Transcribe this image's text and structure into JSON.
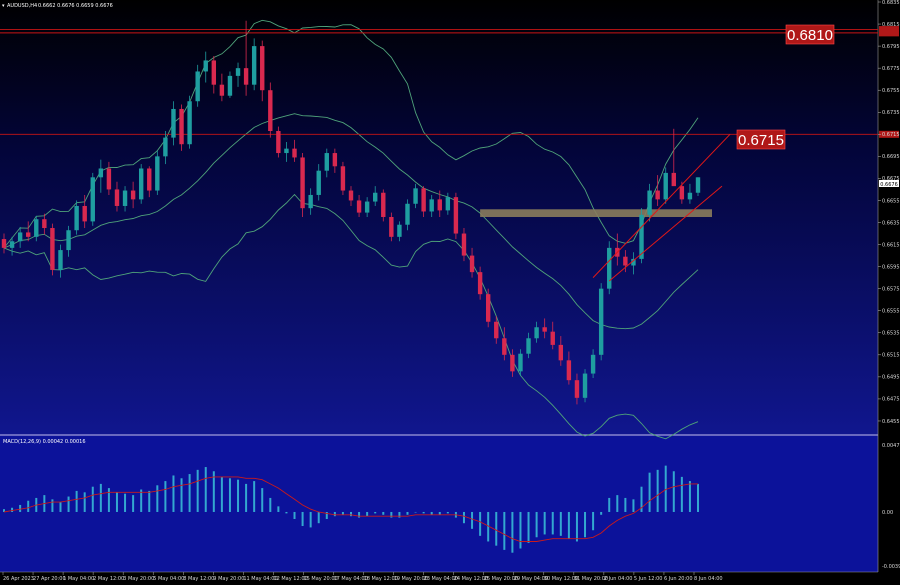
{
  "chart_header": {
    "symbol_label": "AUDUSD,H4",
    "ohlc_label": "0.6662 0.6676 0.6659 0.6676"
  },
  "indicator_header": {
    "label": "MACD(12,26,9) 0.00042 0.00016"
  },
  "price_axis": {
    "ticks": [
      "0.6835",
      "0.6815",
      "0.6795",
      "0.6775",
      "0.6755",
      "0.6735",
      "0.6715",
      "0.6695",
      "0.6675",
      "0.6655",
      "0.6635",
      "0.6615",
      "0.6595",
      "0.6575",
      "0.6555",
      "0.6535",
      "0.6515",
      "0.6495",
      "0.6475",
      "0.6455"
    ],
    "current_price_label": "0.6676"
  },
  "macd_axis": {
    "ticks": [
      "0.00477",
      "0.00",
      "-0.00399"
    ]
  },
  "time_axis": {
    "ticks": [
      "26 Apr 2023",
      "27 Apr 20:00",
      "1 May 04:00",
      "2 May 12:00",
      "3 May 20:00",
      "5 May 04:00",
      "8 May 12:00",
      "9 May 20:00",
      "11 May 04:00",
      "12 May 12:00",
      "15 May 20:00",
      "17 May 04:00",
      "18 May 12:00",
      "19 May 20:00",
      "23 May 04:00",
      "24 May 12:00",
      "25 May 20:00",
      "29 May 04:00",
      "30 May 12:00",
      "31 May 20:00",
      "2 Jun 04:00",
      "5 Jun 12:00",
      "6 Jun 20:00",
      "8 Jun 04:00"
    ]
  },
  "annotations": {
    "level_high_label": "0.6810",
    "level_mid_label": "0.6715"
  },
  "colors": {
    "background_top": "#000000",
    "background_bottom": "#0f1488",
    "bull_candle": "#1f9ea0",
    "bear_candle": "#d9294f",
    "bollinger": "#4fa37a",
    "level_line": "#c81414",
    "level_box_fill": "#b01818",
    "support_zone": "#8a7c5c",
    "trend_line": "#e01818",
    "macd_panel_bg": "#0c129a",
    "macd_hist": "#33a8d0",
    "macd_signal": "#cc1a1a"
  },
  "chart_data": {
    "type": "candlestick",
    "title": "",
    "symbol": "AUDUSD",
    "timeframe": "H4",
    "ylim": [
      0.6445,
      0.6835
    ],
    "horizontal_levels": [
      0.681,
      0.6807,
      0.6715
    ],
    "support_zone": [
      0.664,
      0.6647
    ],
    "ohlc": [
      [
        0.662,
        0.6625,
        0.6607,
        0.6612
      ],
      [
        0.6612,
        0.6622,
        0.6605,
        0.6618
      ],
      [
        0.6618,
        0.6631,
        0.6612,
        0.6626
      ],
      [
        0.6626,
        0.6636,
        0.6618,
        0.6622
      ],
      [
        0.6622,
        0.6641,
        0.6618,
        0.6638
      ],
      [
        0.6638,
        0.6643,
        0.6624,
        0.663
      ],
      [
        0.663,
        0.6634,
        0.6587,
        0.6592
      ],
      [
        0.6592,
        0.6615,
        0.6585,
        0.661
      ],
      [
        0.661,
        0.6632,
        0.6604,
        0.6628
      ],
      [
        0.6628,
        0.6655,
        0.6624,
        0.665
      ],
      [
        0.665,
        0.666,
        0.663,
        0.6636
      ],
      [
        0.6636,
        0.668,
        0.6632,
        0.6676
      ],
      [
        0.6676,
        0.6692,
        0.6662,
        0.6684
      ],
      [
        0.6684,
        0.669,
        0.666,
        0.6665
      ],
      [
        0.6665,
        0.6672,
        0.6645,
        0.665
      ],
      [
        0.665,
        0.6668,
        0.6645,
        0.6664
      ],
      [
        0.6664,
        0.6672,
        0.6648,
        0.6656
      ],
      [
        0.6656,
        0.6688,
        0.6652,
        0.6684
      ],
      [
        0.6684,
        0.6686,
        0.6658,
        0.6664
      ],
      [
        0.6664,
        0.67,
        0.666,
        0.6695
      ],
      [
        0.6695,
        0.6718,
        0.6688,
        0.6712
      ],
      [
        0.6712,
        0.6745,
        0.6705,
        0.6738
      ],
      [
        0.6738,
        0.6742,
        0.67,
        0.6706
      ],
      [
        0.6706,
        0.675,
        0.6702,
        0.6745
      ],
      [
        0.6745,
        0.6778,
        0.674,
        0.6772
      ],
      [
        0.6772,
        0.679,
        0.6762,
        0.6782
      ],
      [
        0.6782,
        0.6786,
        0.6752,
        0.676
      ],
      [
        0.676,
        0.677,
        0.6745,
        0.675
      ],
      [
        0.675,
        0.6772,
        0.6748,
        0.6768
      ],
      [
        0.6768,
        0.678,
        0.6758,
        0.6775
      ],
      [
        0.6775,
        0.6818,
        0.675,
        0.676
      ],
      [
        0.676,
        0.6802,
        0.6755,
        0.6795
      ],
      [
        0.6795,
        0.68,
        0.6745,
        0.6755
      ],
      [
        0.6755,
        0.6762,
        0.6712,
        0.6718
      ],
      [
        0.6718,
        0.6722,
        0.6694,
        0.6698
      ],
      [
        0.6698,
        0.6708,
        0.669,
        0.6702
      ],
      [
        0.6702,
        0.671,
        0.669,
        0.6694
      ],
      [
        0.6694,
        0.6698,
        0.664,
        0.6648
      ],
      [
        0.6648,
        0.6666,
        0.6642,
        0.666
      ],
      [
        0.666,
        0.6688,
        0.6655,
        0.6682
      ],
      [
        0.6682,
        0.6702,
        0.6676,
        0.6698
      ],
      [
        0.6698,
        0.6702,
        0.668,
        0.6686
      ],
      [
        0.6686,
        0.669,
        0.666,
        0.6664
      ],
      [
        0.6664,
        0.6668,
        0.665,
        0.6655
      ],
      [
        0.6655,
        0.666,
        0.664,
        0.6644
      ],
      [
        0.6644,
        0.6658,
        0.664,
        0.6654
      ],
      [
        0.6654,
        0.6668,
        0.665,
        0.6662
      ],
      [
        0.6662,
        0.6665,
        0.6636,
        0.664
      ],
      [
        0.664,
        0.6644,
        0.6618,
        0.6622
      ],
      [
        0.6622,
        0.6636,
        0.6618,
        0.6633
      ],
      [
        0.6633,
        0.6656,
        0.6628,
        0.6652
      ],
      [
        0.6652,
        0.667,
        0.6648,
        0.6666
      ],
      [
        0.6666,
        0.6668,
        0.664,
        0.6645
      ],
      [
        0.6645,
        0.666,
        0.664,
        0.6656
      ],
      [
        0.6656,
        0.6664,
        0.664,
        0.6646
      ],
      [
        0.6646,
        0.6662,
        0.6642,
        0.6658
      ],
      [
        0.6658,
        0.6662,
        0.662,
        0.6625
      ],
      [
        0.6625,
        0.663,
        0.66,
        0.6605
      ],
      [
        0.6605,
        0.6612,
        0.6585,
        0.659
      ],
      [
        0.659,
        0.6595,
        0.6565,
        0.657
      ],
      [
        0.657,
        0.6575,
        0.654,
        0.6545
      ],
      [
        0.6545,
        0.655,
        0.6525,
        0.653
      ],
      [
        0.653,
        0.654,
        0.651,
        0.6515
      ],
      [
        0.6515,
        0.652,
        0.6495,
        0.65
      ],
      [
        0.65,
        0.652,
        0.6496,
        0.6516
      ],
      [
        0.6516,
        0.6535,
        0.6512,
        0.653
      ],
      [
        0.653,
        0.6545,
        0.6526,
        0.654
      ],
      [
        0.654,
        0.6548,
        0.653,
        0.6536
      ],
      [
        0.6536,
        0.6545,
        0.652,
        0.6524
      ],
      [
        0.6524,
        0.6532,
        0.6505,
        0.651
      ],
      [
        0.651,
        0.6518,
        0.6488,
        0.6492
      ],
      [
        0.6492,
        0.6498,
        0.647,
        0.6476
      ],
      [
        0.6476,
        0.6502,
        0.6472,
        0.6498
      ],
      [
        0.6498,
        0.652,
        0.6494,
        0.6515
      ],
      [
        0.6515,
        0.658,
        0.651,
        0.6575
      ],
      [
        0.6575,
        0.6618,
        0.657,
        0.6612
      ],
      [
        0.6612,
        0.6625,
        0.6596,
        0.6604
      ],
      [
        0.6604,
        0.661,
        0.659,
        0.6596
      ],
      [
        0.6596,
        0.6608,
        0.6588,
        0.6602
      ],
      [
        0.6602,
        0.6648,
        0.6598,
        0.6642
      ],
      [
        0.6642,
        0.667,
        0.6636,
        0.6664
      ],
      [
        0.6664,
        0.6678,
        0.665,
        0.6656
      ],
      [
        0.6656,
        0.6685,
        0.6652,
        0.668
      ],
      [
        0.668,
        0.672,
        0.667,
        0.6668
      ],
      [
        0.6668,
        0.6672,
        0.6652,
        0.6656
      ],
      [
        0.6656,
        0.667,
        0.6652,
        0.6662
      ],
      [
        0.6662,
        0.6676,
        0.6659,
        0.6676
      ]
    ],
    "series": [
      {
        "name": "MACD histogram",
        "values": [
          0.0002,
          0.0003,
          0.0005,
          0.0008,
          0.001,
          0.0012,
          0.0009,
          0.0007,
          0.0011,
          0.0015,
          0.0014,
          0.0018,
          0.002,
          0.0017,
          0.0014,
          0.0013,
          0.0012,
          0.0016,
          0.0015,
          0.0019,
          0.0022,
          0.0026,
          0.0024,
          0.0027,
          0.003,
          0.0032,
          0.0029,
          0.0025,
          0.0024,
          0.0023,
          0.002,
          0.0022,
          0.0017,
          0.001,
          0.0004,
          -0.0001,
          -0.0005,
          -0.001,
          -0.0011,
          -0.0008,
          -0.0005,
          -0.0003,
          -0.0002,
          -0.0003,
          -0.0004,
          -0.0003,
          -0.0001,
          -0.0002,
          -0.0004,
          -0.0004,
          -0.0002,
          0.0,
          -0.0001,
          -0.0002,
          -0.0002,
          -0.0001,
          -0.0004,
          -0.0008,
          -0.0012,
          -0.0017,
          -0.0021,
          -0.0024,
          -0.0027,
          -0.0029,
          -0.0026,
          -0.0022,
          -0.0018,
          -0.0016,
          -0.0016,
          -0.0017,
          -0.0019,
          -0.0021,
          -0.0018,
          -0.0013,
          -0.0002,
          0.001,
          0.0012,
          0.001,
          0.0009,
          0.0018,
          0.0028,
          0.003,
          0.0033,
          0.0029,
          0.0025,
          0.0022,
          0.002
        ]
      },
      {
        "name": "Signal",
        "values": [
          0.0,
          0.0001,
          0.0002,
          0.0003,
          0.0005,
          0.0006,
          0.0007,
          0.0007,
          0.0008,
          0.0009,
          0.001,
          0.0012,
          0.0013,
          0.0014,
          0.0014,
          0.0014,
          0.0014,
          0.0014,
          0.0014,
          0.0015,
          0.0016,
          0.0018,
          0.0019,
          0.002,
          0.0022,
          0.0024,
          0.0025,
          0.0025,
          0.0025,
          0.0025,
          0.0024,
          0.0024,
          0.0023,
          0.002,
          0.0017,
          0.0013,
          0.0009,
          0.0005,
          0.0002,
          0.0,
          -0.0001,
          -0.0002,
          -0.0002,
          -0.0002,
          -0.0003,
          -0.0003,
          -0.0003,
          -0.0003,
          -0.0003,
          -0.0003,
          -0.0003,
          -0.0002,
          -0.0002,
          -0.0002,
          -0.0002,
          -0.0002,
          -0.0002,
          -0.0003,
          -0.0005,
          -0.0007,
          -0.001,
          -0.0013,
          -0.0016,
          -0.0019,
          -0.0021,
          -0.0021,
          -0.0021,
          -0.002,
          -0.0019,
          -0.0019,
          -0.0019,
          -0.0019,
          -0.0019,
          -0.0018,
          -0.0015,
          -0.001,
          -0.0006,
          -0.0003,
          -0.0001,
          0.0003,
          0.0008,
          0.0012,
          0.0016,
          0.0018,
          0.0019,
          0.002,
          0.002
        ]
      }
    ]
  }
}
